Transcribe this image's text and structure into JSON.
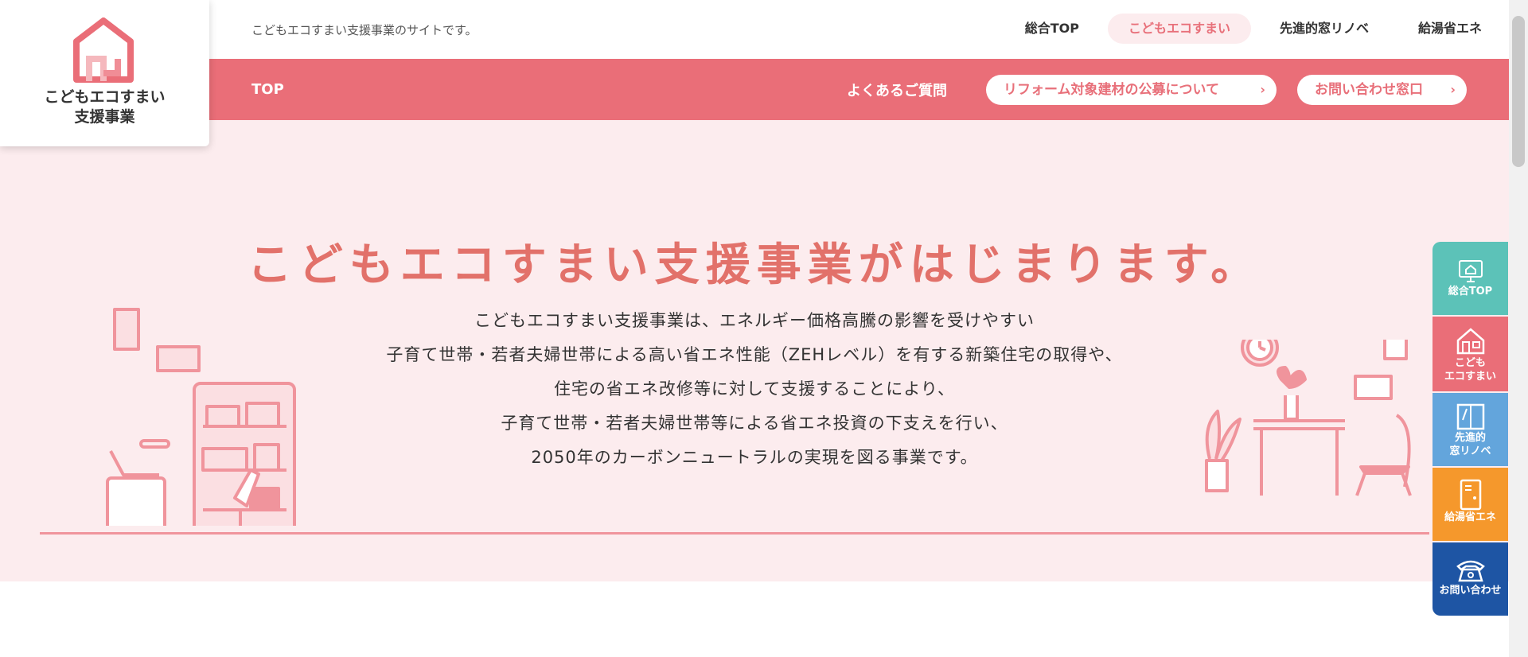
{
  "header": {
    "site_description": "こどもエコすまい支援事業のサイトです。",
    "nav": [
      {
        "label": "総合TOP",
        "active": false
      },
      {
        "label": "こどもエコすまい",
        "active": true
      },
      {
        "label": "先進的窓リノベ",
        "active": false
      },
      {
        "label": "給湯省エネ",
        "active": false
      }
    ]
  },
  "logo": {
    "line1": "こどもエコすまい",
    "line2": "支援事業"
  },
  "subnav": {
    "top_label": "TOP",
    "faq_label": "よくあるご質問",
    "pill1_label": "リフォーム対象建材の公募について",
    "pill2_label": "お問い合わせ窓口",
    "chevron": "›"
  },
  "hero": {
    "title": "こどもエコすまい支援事業がはじまります。",
    "lines": [
      "こどもエコすまい支援事業は、エネルギー価格高騰の影響を受けやすい",
      "子育て世帯・若者夫婦世帯による高い省エネ性能（ZEHレベル）を有する新築住宅の取得や、",
      "住宅の省エネ改修等に対して支援することにより、",
      "子育て世帯・若者夫婦世帯等による省エネ投資の下支えを行い、",
      "2050年のカーボンニュートラルの実現を図る事業です。"
    ]
  },
  "sidenav": [
    {
      "label": "総合TOP",
      "icon": "monitor-home-icon"
    },
    {
      "label_line1": "こども",
      "label_line2": "エコすまい",
      "icon": "house-icon"
    },
    {
      "label_line1": "先進的",
      "label_line2": "窓リノベ",
      "icon": "window-icon"
    },
    {
      "label": "給湯省エネ",
      "icon": "water-heater-icon"
    },
    {
      "label": "お問い合わせ",
      "icon": "telephone-icon"
    }
  ],
  "colors": {
    "brand_pink": "#ea6e78",
    "hero_bg": "#fcecee",
    "title_coral": "#e2716a",
    "teal": "#5cc2b8",
    "blue": "#63a5dc",
    "orange": "#f5982c",
    "navy": "#1e55a4"
  }
}
